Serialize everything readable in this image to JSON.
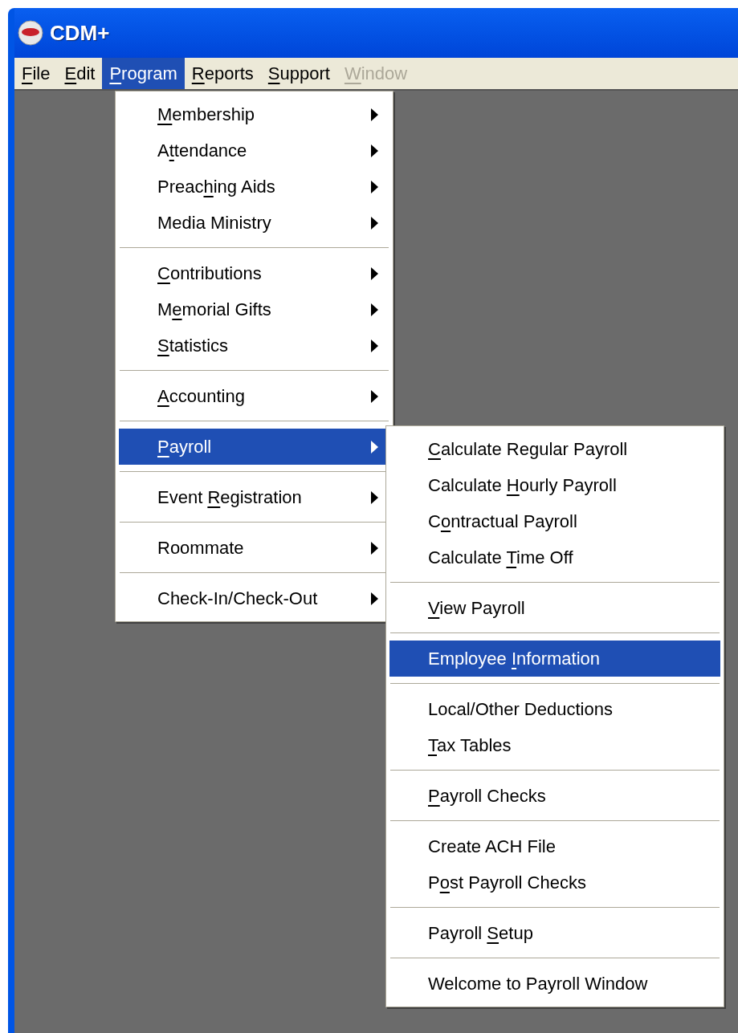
{
  "window": {
    "title": "CDM+"
  },
  "menu_bar": [
    {
      "key": "F",
      "post": "ile",
      "selected": false,
      "disabled": false
    },
    {
      "key": "E",
      "post": "dit",
      "selected": false,
      "disabled": false
    },
    {
      "key": "P",
      "post": "rogram",
      "selected": true,
      "disabled": false
    },
    {
      "key": "R",
      "post": "eports",
      "selected": false,
      "disabled": false
    },
    {
      "key": "S",
      "post": "upport",
      "selected": false,
      "disabled": false
    },
    {
      "key": "W",
      "post": "indow",
      "selected": false,
      "disabled": true
    }
  ],
  "program_menu": {
    "groups": [
      [
        {
          "key": "M",
          "post": "embership",
          "selected": false,
          "submenu": true
        },
        {
          "pre": "A",
          "key": "t",
          "post": "tendance",
          "selected": false,
          "submenu": true
        },
        {
          "pre": "Preac",
          "key": "h",
          "post": "ing Aids",
          "selected": false,
          "submenu": true
        },
        {
          "text": "Media Ministry",
          "selected": false,
          "submenu": true
        }
      ],
      [
        {
          "key": "C",
          "post": "ontributions",
          "selected": false,
          "submenu": true
        },
        {
          "pre": "M",
          "key": "e",
          "post": "morial Gifts",
          "selected": false,
          "submenu": true
        },
        {
          "key": "S",
          "post": "tatistics",
          "selected": false,
          "submenu": true
        }
      ],
      [
        {
          "key": "A",
          "post": "ccounting",
          "selected": false,
          "submenu": true
        }
      ],
      [
        {
          "key": "P",
          "post": "ayroll",
          "selected": true,
          "submenu": true
        }
      ],
      [
        {
          "pre": "Event ",
          "key": "R",
          "post": "egistration",
          "selected": false,
          "submenu": true
        }
      ],
      [
        {
          "text": "Roommate",
          "selected": false,
          "submenu": true
        }
      ],
      [
        {
          "text": "Check-In/Check-Out",
          "selected": false,
          "submenu": true
        }
      ]
    ]
  },
  "payroll_menu": {
    "groups": [
      [
        {
          "key": "C",
          "post": "alculate Regular Payroll",
          "selected": false,
          "submenu": false
        },
        {
          "pre": "Calculate ",
          "key": "H",
          "post": "ourly Payroll",
          "selected": false,
          "submenu": false
        },
        {
          "pre": "C",
          "key": "o",
          "post": "ntractual Payroll",
          "selected": false,
          "submenu": false
        },
        {
          "pre": "Calculate ",
          "key": "T",
          "post": "ime Off",
          "selected": false,
          "submenu": false
        }
      ],
      [
        {
          "key": "V",
          "post": "iew Payroll",
          "selected": false,
          "submenu": false
        }
      ],
      [
        {
          "pre": "Employee ",
          "key": "I",
          "post": "nformation",
          "selected": true,
          "submenu": false
        }
      ],
      [
        {
          "text": "Local/Other Deductions",
          "selected": false,
          "submenu": false
        },
        {
          "key": "T",
          "post": "ax Tables",
          "selected": false,
          "submenu": false
        }
      ],
      [
        {
          "key": "P",
          "post": "ayroll Checks",
          "selected": false,
          "submenu": false
        }
      ],
      [
        {
          "text": "Create ACH File",
          "selected": false,
          "submenu": false
        },
        {
          "pre": "P",
          "key": "o",
          "post": "st Payroll Checks",
          "selected": false,
          "submenu": false
        }
      ],
      [
        {
          "pre": "Payroll ",
          "key": "S",
          "post": "etup",
          "selected": false,
          "submenu": false
        }
      ],
      [
        {
          "text": "Welcome to Payroll Window",
          "selected": false,
          "submenu": false
        }
      ]
    ]
  }
}
